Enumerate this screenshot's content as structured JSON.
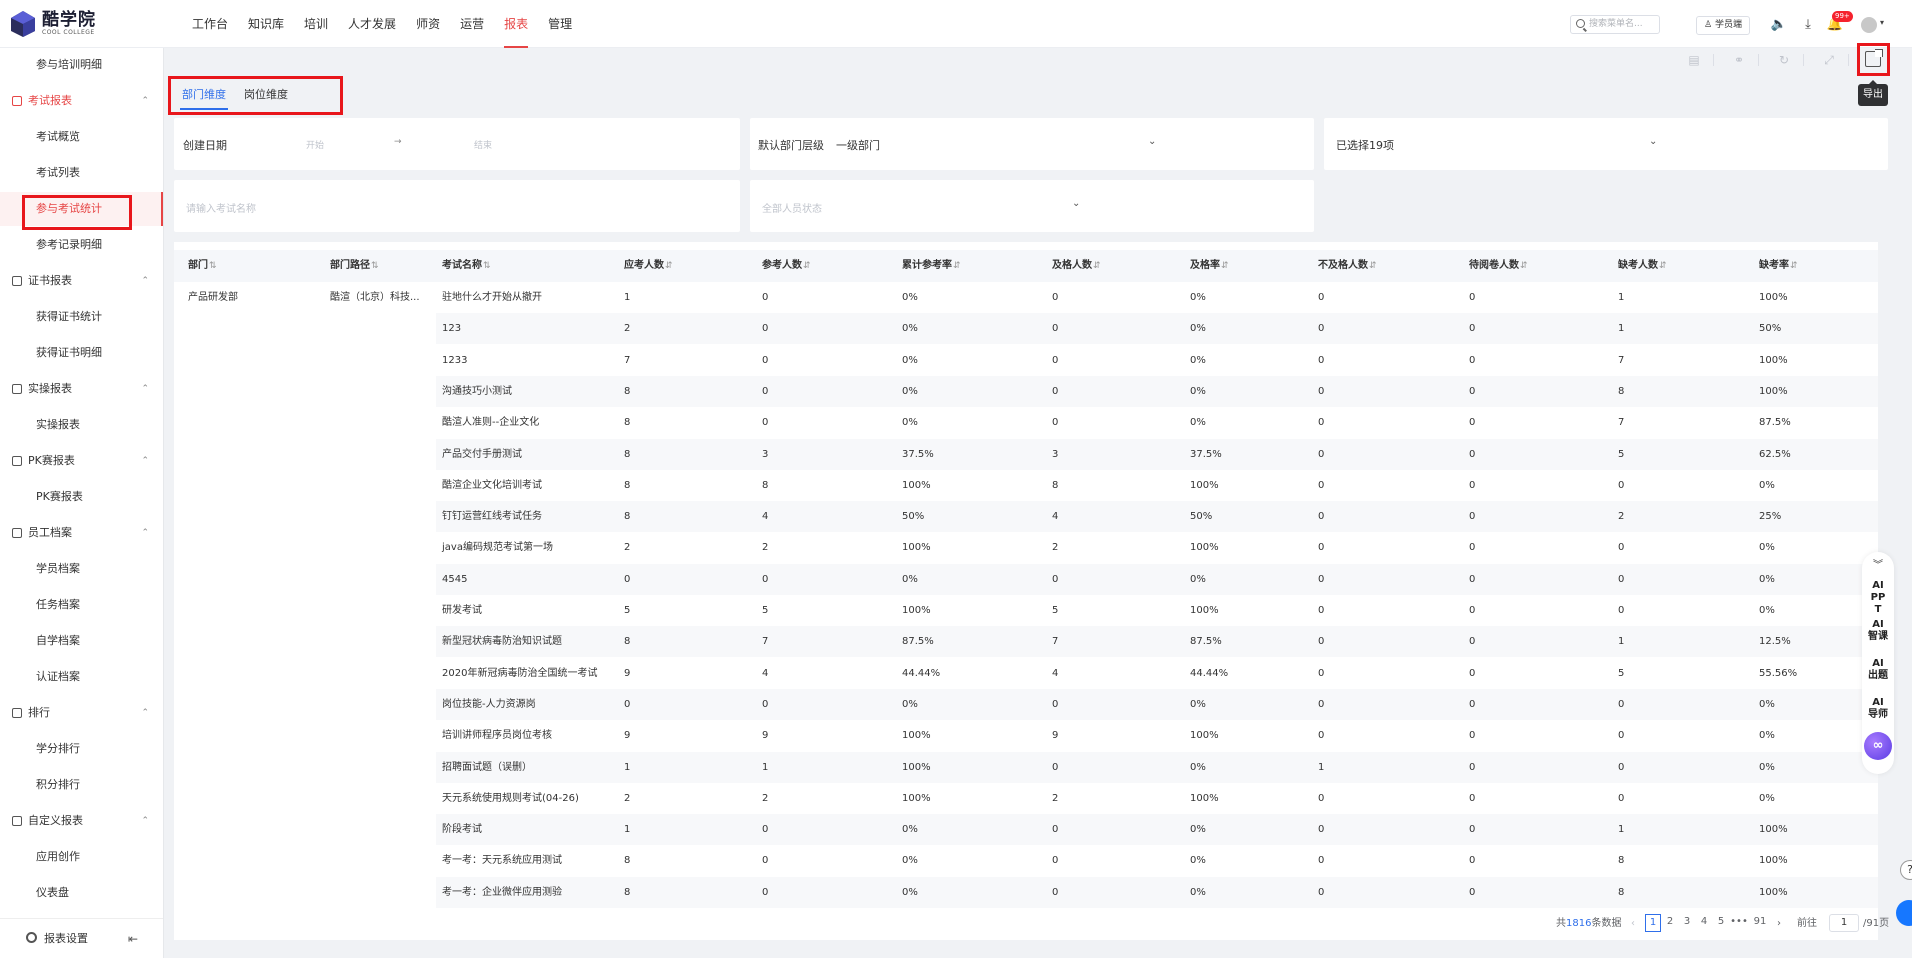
{
  "logo": {
    "cn": "酷学院",
    "en": "COOL COLLEGE"
  },
  "nav": [
    "工作台",
    "知识库",
    "培训",
    "人才发展",
    "师资",
    "运营",
    "报表",
    "管理"
  ],
  "nav_active": "报表",
  "topbar": {
    "search_placeholder": "搜索菜单名...",
    "student_label": "学员端",
    "badge": "99+"
  },
  "sidebar": {
    "items": [
      {
        "label": "参与培训明细",
        "type": "sub"
      },
      {
        "label": "考试报表",
        "type": "group",
        "active": true
      },
      {
        "label": "考试概览",
        "type": "sub"
      },
      {
        "label": "考试列表",
        "type": "sub"
      },
      {
        "label": "参与考试统计",
        "type": "sub",
        "active": true
      },
      {
        "label": "参考记录明细",
        "type": "sub"
      },
      {
        "label": "证书报表",
        "type": "group"
      },
      {
        "label": "获得证书统计",
        "type": "sub"
      },
      {
        "label": "获得证书明细",
        "type": "sub"
      },
      {
        "label": "实操报表",
        "type": "group"
      },
      {
        "label": "实操报表",
        "type": "sub"
      },
      {
        "label": "PK赛报表",
        "type": "group"
      },
      {
        "label": "PK赛报表",
        "type": "sub"
      },
      {
        "label": "员工档案",
        "type": "group"
      },
      {
        "label": "学员档案",
        "type": "sub"
      },
      {
        "label": "任务档案",
        "type": "sub"
      },
      {
        "label": "自学档案",
        "type": "sub"
      },
      {
        "label": "认证档案",
        "type": "sub"
      },
      {
        "label": "排行",
        "type": "group"
      },
      {
        "label": "学分排行",
        "type": "sub"
      },
      {
        "label": "积分排行",
        "type": "sub"
      },
      {
        "label": "自定义报表",
        "type": "group"
      },
      {
        "label": "应用创作",
        "type": "sub"
      },
      {
        "label": "仪表盘",
        "type": "sub"
      }
    ],
    "footer_label": "报表设置"
  },
  "toolbar": {
    "export_tooltip": "导出"
  },
  "tabs": [
    "部门维度",
    "岗位维度"
  ],
  "filters": {
    "create_date_label": "创建日期",
    "date_start_placeholder": "开始",
    "date_sep": "→",
    "date_end_placeholder": "结束",
    "dept_level_label": "默认部门层级",
    "dept_level_value": "一级部门",
    "selected_label": "已选择19项",
    "exam_name_placeholder": "请输入考试名称",
    "status_placeholder": "全部人员状态"
  },
  "table": {
    "columns": [
      "部门",
      "部门路径",
      "考试名称",
      "应考人数",
      "参考人数",
      "累计参考率",
      "及格人数",
      "及格率",
      "不及格人数",
      "待阅卷人数",
      "缺考人数",
      "缺考率"
    ],
    "dept": "产品研发部",
    "dept_path": "酷渲（北京）科技...",
    "rows": [
      [
        "驻地什么才开始从撤开",
        "1",
        "0",
        "0%",
        "0",
        "0%",
        "0",
        "0",
        "1",
        "100%"
      ],
      [
        "123",
        "2",
        "0",
        "0%",
        "0",
        "0%",
        "0",
        "0",
        "1",
        "50%"
      ],
      [
        "1233",
        "7",
        "0",
        "0%",
        "0",
        "0%",
        "0",
        "0",
        "7",
        "100%"
      ],
      [
        "沟通技巧小测试",
        "8",
        "0",
        "0%",
        "0",
        "0%",
        "0",
        "0",
        "8",
        "100%"
      ],
      [
        "酷渲人准则--企业文化",
        "8",
        "0",
        "0%",
        "0",
        "0%",
        "0",
        "0",
        "7",
        "87.5%"
      ],
      [
        "产品交付手册测试",
        "8",
        "3",
        "37.5%",
        "3",
        "37.5%",
        "0",
        "0",
        "5",
        "62.5%"
      ],
      [
        "酷渲企业文化培训考试",
        "8",
        "8",
        "100%",
        "8",
        "100%",
        "0",
        "0",
        "0",
        "0%"
      ],
      [
        "钉钉运营红线考试任务",
        "8",
        "4",
        "50%",
        "4",
        "50%",
        "0",
        "0",
        "2",
        "25%"
      ],
      [
        "java编码规范考试第一场",
        "2",
        "2",
        "100%",
        "2",
        "100%",
        "0",
        "0",
        "0",
        "0%"
      ],
      [
        "4545",
        "0",
        "0",
        "0%",
        "0",
        "0%",
        "0",
        "0",
        "0",
        "0%"
      ],
      [
        "研发考试",
        "5",
        "5",
        "100%",
        "5",
        "100%",
        "0",
        "0",
        "0",
        "0%"
      ],
      [
        "新型冠状病毒防治知识试题",
        "8",
        "7",
        "87.5%",
        "7",
        "87.5%",
        "0",
        "0",
        "1",
        "12.5%"
      ],
      [
        "2020年新冠病毒防治全国统一考试",
        "9",
        "4",
        "44.44%",
        "4",
        "44.44%",
        "0",
        "0",
        "5",
        "55.56%"
      ],
      [
        "岗位技能-人力资源岗",
        "0",
        "0",
        "0%",
        "0",
        "0%",
        "0",
        "0",
        "0",
        "0%"
      ],
      [
        "培训讲师程序员岗位考核",
        "9",
        "9",
        "100%",
        "9",
        "100%",
        "0",
        "0",
        "0",
        "0%"
      ],
      [
        "招聘面试题（误删）",
        "1",
        "1",
        "100%",
        "0",
        "0%",
        "1",
        "0",
        "0",
        "0%"
      ],
      [
        "天元系统使用规则考试(04-26)",
        "2",
        "2",
        "100%",
        "2",
        "100%",
        "0",
        "0",
        "0",
        "0%"
      ],
      [
        "阶段考试",
        "1",
        "0",
        "0%",
        "0",
        "0%",
        "0",
        "0",
        "1",
        "100%"
      ],
      [
        "考一考：天元系统应用测试",
        "8",
        "0",
        "0%",
        "0",
        "0%",
        "0",
        "0",
        "8",
        "100%"
      ],
      [
        "考一考：企业微伴应用测验",
        "8",
        "0",
        "0%",
        "0",
        "0%",
        "0",
        "0",
        "8",
        "100%"
      ]
    ]
  },
  "pagination": {
    "total_prefix": "共",
    "total": "1816",
    "total_suffix": "条数据",
    "pages": [
      "1",
      "2",
      "3",
      "4",
      "5",
      "•••",
      "91"
    ],
    "goto_label": "前往",
    "current": "1",
    "total_pages": "/91页"
  },
  "ai_panel": {
    "items": [
      "AI PPT",
      "AI 智课",
      "AI 出题",
      "AI 导师"
    ]
  }
}
